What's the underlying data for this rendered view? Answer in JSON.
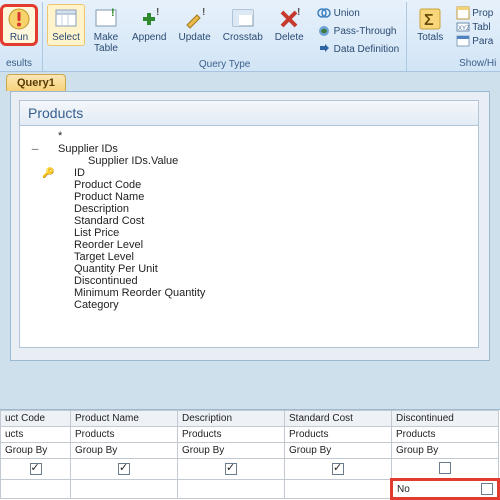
{
  "ribbon": {
    "results": {
      "run": "Run",
      "caption": "esults"
    },
    "queryType": {
      "select": "Select",
      "makeTable": "Make\nTable",
      "append": "Append",
      "update": "Update",
      "crosstab": "Crosstab",
      "delete": "Delete",
      "union": "Union",
      "passThrough": "Pass-Through",
      "dataDefinition": "Data Definition",
      "caption": "Query Type"
    },
    "showHide": {
      "totals": "Totals",
      "propSheet": "Prop",
      "tableNames": "Tabl",
      "parameters": "Para",
      "caption": "Show/Hi"
    }
  },
  "tabs": {
    "query1": "Query1"
  },
  "tableBox": {
    "title": "Products",
    "fields": [
      {
        "text": "*",
        "toggle": "",
        "key": "",
        "indent": 0
      },
      {
        "text": "Supplier IDs",
        "toggle": "–",
        "key": "",
        "indent": 0
      },
      {
        "text": "Supplier IDs.Value",
        "toggle": "",
        "key": "",
        "indent": 2
      },
      {
        "text": "ID",
        "toggle": "",
        "key": "🔑",
        "indent": 1
      },
      {
        "text": "Product Code",
        "toggle": "",
        "key": "",
        "indent": 1
      },
      {
        "text": "Product Name",
        "toggle": "",
        "key": "",
        "indent": 1
      },
      {
        "text": "Description",
        "toggle": "",
        "key": "",
        "indent": 1
      },
      {
        "text": "Standard Cost",
        "toggle": "",
        "key": "",
        "indent": 1
      },
      {
        "text": "List Price",
        "toggle": "",
        "key": "",
        "indent": 1
      },
      {
        "text": "Reorder Level",
        "toggle": "",
        "key": "",
        "indent": 1
      },
      {
        "text": "Target Level",
        "toggle": "",
        "key": "",
        "indent": 1
      },
      {
        "text": "Quantity Per Unit",
        "toggle": "",
        "key": "",
        "indent": 1
      },
      {
        "text": "Discontinued",
        "toggle": "",
        "key": "",
        "indent": 1
      },
      {
        "text": "Minimum Reorder Quantity",
        "toggle": "",
        "key": "",
        "indent": 1
      },
      {
        "text": "Category",
        "toggle": "",
        "key": "",
        "indent": 1
      }
    ]
  },
  "grid": {
    "cols": [
      {
        "field": "uct Code",
        "table": "ucts",
        "total": "Group By",
        "show": true,
        "criteria": ""
      },
      {
        "field": "Product Name",
        "table": "Products",
        "total": "Group By",
        "show": true,
        "criteria": ""
      },
      {
        "field": "Description",
        "table": "Products",
        "total": "Group By",
        "show": true,
        "criteria": ""
      },
      {
        "field": "Standard Cost",
        "table": "Products",
        "total": "Group By",
        "show": true,
        "criteria": ""
      },
      {
        "field": "Discontinued",
        "table": "Products",
        "total": "Group By",
        "show": false,
        "criteria": "No",
        "highlight": true
      }
    ]
  }
}
